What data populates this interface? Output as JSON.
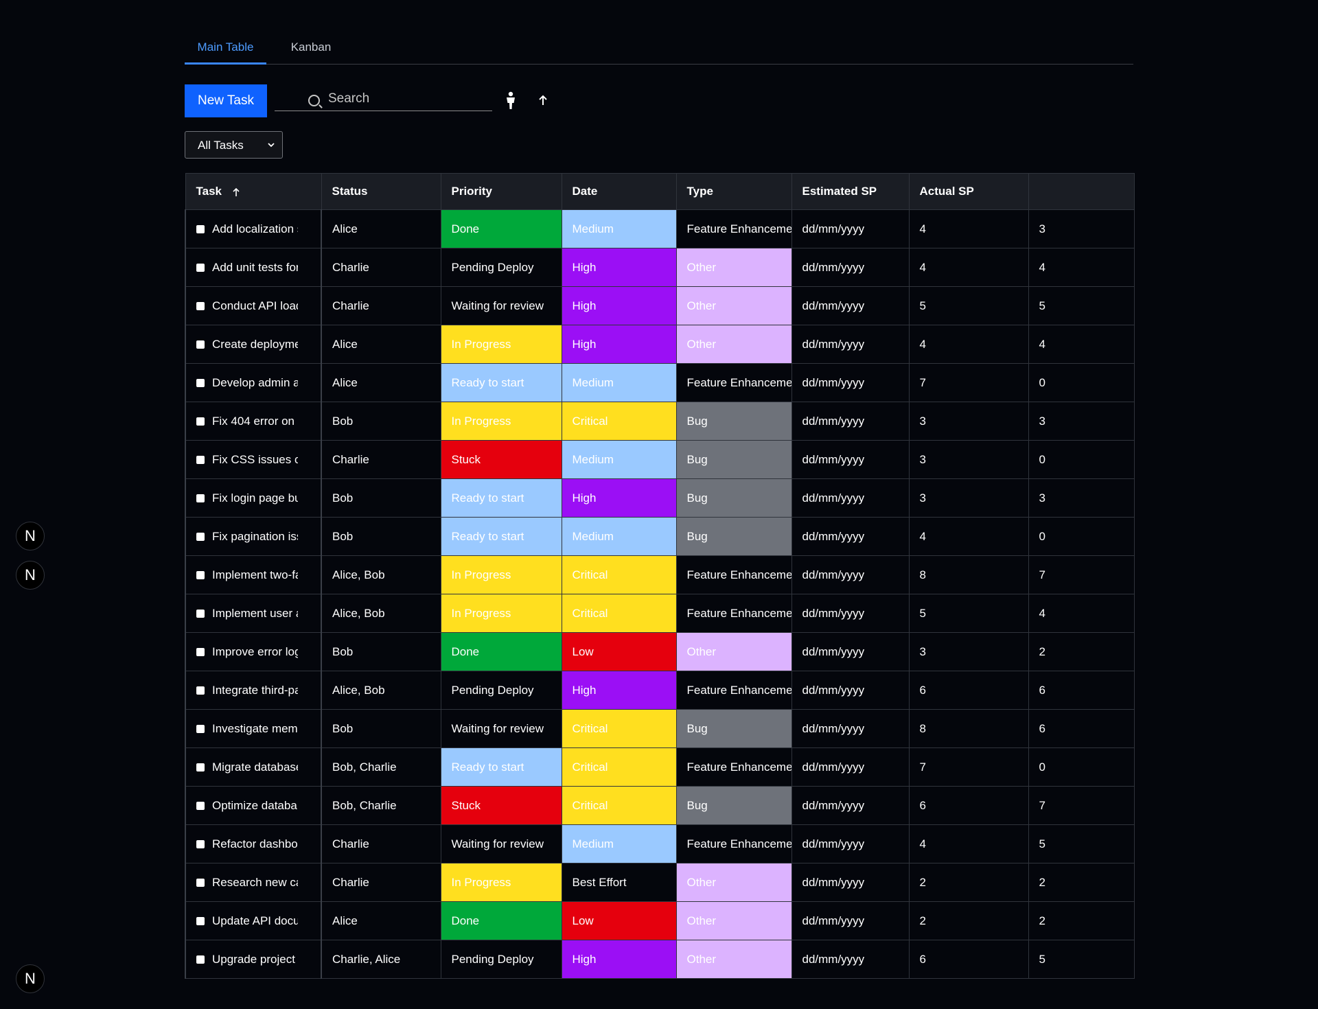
{
  "tabs": [
    "Main Table",
    "Kanban"
  ],
  "toolbar": {
    "new_task_label": "New Task",
    "search_placeholder": "Search"
  },
  "filter": {
    "selected": "All Tasks"
  },
  "badges": [
    "N",
    "N",
    "N"
  ],
  "colors": {
    "Done": "#00a83a",
    "Pending Deploy": "transparent",
    "Waiting for review": "transparent",
    "In Progress": "#ffdf1f",
    "Ready to start": "#9ac9ff",
    "Stuck": "#e5000d",
    "Medium": "#9ac9ff",
    "High": "#9b0ff5",
    "Critical": "#ffdf1f",
    "Low": "#e5000d",
    "Best Effort": "transparent",
    "Feature Enhancement": "transparent",
    "Other": "#dcb3ff",
    "Bug": "#6e727a"
  },
  "table": {
    "headers": [
      "Task",
      "Status",
      "Priority",
      "Date",
      "Type",
      "Estimated SP",
      "Actual SP",
      ""
    ],
    "rows": [
      {
        "task": "Add localization support",
        "person": "Alice",
        "status": "Done",
        "priority": "Medium",
        "type": "Feature Enhancement",
        "date": "dd/mm/yyyy",
        "est": "4",
        "act": "3"
      },
      {
        "task": "Add unit tests for",
        "person": "Charlie",
        "status": "Pending Deploy",
        "priority": "High",
        "type": "Other",
        "date": "dd/mm/yyyy",
        "est": "4",
        "act": "4"
      },
      {
        "task": "Conduct API load",
        "person": "Charlie",
        "status": "Waiting for review",
        "priority": "High",
        "type": "Other",
        "date": "dd/mm/yyyy",
        "est": "5",
        "act": "5"
      },
      {
        "task": "Create deployment",
        "person": "Alice",
        "status": "In Progress",
        "priority": "High",
        "type": "Other",
        "date": "dd/mm/yyyy",
        "est": "4",
        "act": "4"
      },
      {
        "task": "Develop admin a",
        "person": "Alice",
        "status": "Ready to start",
        "priority": "Medium",
        "type": "Feature Enhancement",
        "date": "dd/mm/yyyy",
        "est": "7",
        "act": "0"
      },
      {
        "task": "Fix 404 error on",
        "person": "Bob",
        "status": "In Progress",
        "priority": "Critical",
        "type": "Bug",
        "date": "dd/mm/yyyy",
        "est": "3",
        "act": "3"
      },
      {
        "task": "Fix CSS issues c",
        "person": "Charlie",
        "status": "Stuck",
        "priority": "Medium",
        "type": "Bug",
        "date": "dd/mm/yyyy",
        "est": "3",
        "act": "0"
      },
      {
        "task": "Fix login page bu",
        "person": "Bob",
        "status": "Ready to start",
        "priority": "High",
        "type": "Bug",
        "date": "dd/mm/yyyy",
        "est": "3",
        "act": "3"
      },
      {
        "task": "Fix pagination iss",
        "person": "Bob",
        "status": "Ready to start",
        "priority": "Medium",
        "type": "Bug",
        "date": "dd/mm/yyyy",
        "est": "4",
        "act": "0"
      },
      {
        "task": "Implement two-fa",
        "person": "Alice, Bob",
        "status": "In Progress",
        "priority": "Critical",
        "type": "Feature Enhancement",
        "date": "dd/mm/yyyy",
        "est": "8",
        "act": "7"
      },
      {
        "task": "Implement user a",
        "person": "Alice, Bob",
        "status": "In Progress",
        "priority": "Critical",
        "type": "Feature Enhancement",
        "date": "dd/mm/yyyy",
        "est": "5",
        "act": "4"
      },
      {
        "task": "Improve error log",
        "person": "Bob",
        "status": "Done",
        "priority": "Low",
        "type": "Other",
        "date": "dd/mm/yyyy",
        "est": "3",
        "act": "2"
      },
      {
        "task": "Integrate third-pa",
        "person": "Alice, Bob",
        "status": "Pending Deploy",
        "priority": "High",
        "type": "Feature Enhancement",
        "date": "dd/mm/yyyy",
        "est": "6",
        "act": "6"
      },
      {
        "task": "Investigate mem",
        "person": "Bob",
        "status": "Waiting for review",
        "priority": "Critical",
        "type": "Bug",
        "date": "dd/mm/yyyy",
        "est": "8",
        "act": "6"
      },
      {
        "task": "Migrate database",
        "person": "Bob, Charlie",
        "status": "Ready to start",
        "priority": "Critical",
        "type": "Feature Enhancement",
        "date": "dd/mm/yyyy",
        "est": "7",
        "act": "0"
      },
      {
        "task": "Optimize databa",
        "person": "Bob, Charlie",
        "status": "Stuck",
        "priority": "Critical",
        "type": "Bug",
        "date": "dd/mm/yyyy",
        "est": "6",
        "act": "7"
      },
      {
        "task": "Refactor dashbo",
        "person": "Charlie",
        "status": "Waiting for review",
        "priority": "Medium",
        "type": "Feature Enhancement",
        "date": "dd/mm/yyyy",
        "est": "4",
        "act": "5"
      },
      {
        "task": "Research new ca",
        "person": "Charlie",
        "status": "In Progress",
        "priority": "Best Effort",
        "type": "Other",
        "date": "dd/mm/yyyy",
        "est": "2",
        "act": "2"
      },
      {
        "task": "Update API docu",
        "person": "Alice",
        "status": "Done",
        "priority": "Low",
        "type": "Other",
        "date": "dd/mm/yyyy",
        "est": "2",
        "act": "2"
      },
      {
        "task": "Upgrade project",
        "person": "Charlie, Alice",
        "status": "Pending Deploy",
        "priority": "High",
        "type": "Other",
        "date": "dd/mm/yyyy",
        "est": "6",
        "act": "5"
      }
    ]
  }
}
